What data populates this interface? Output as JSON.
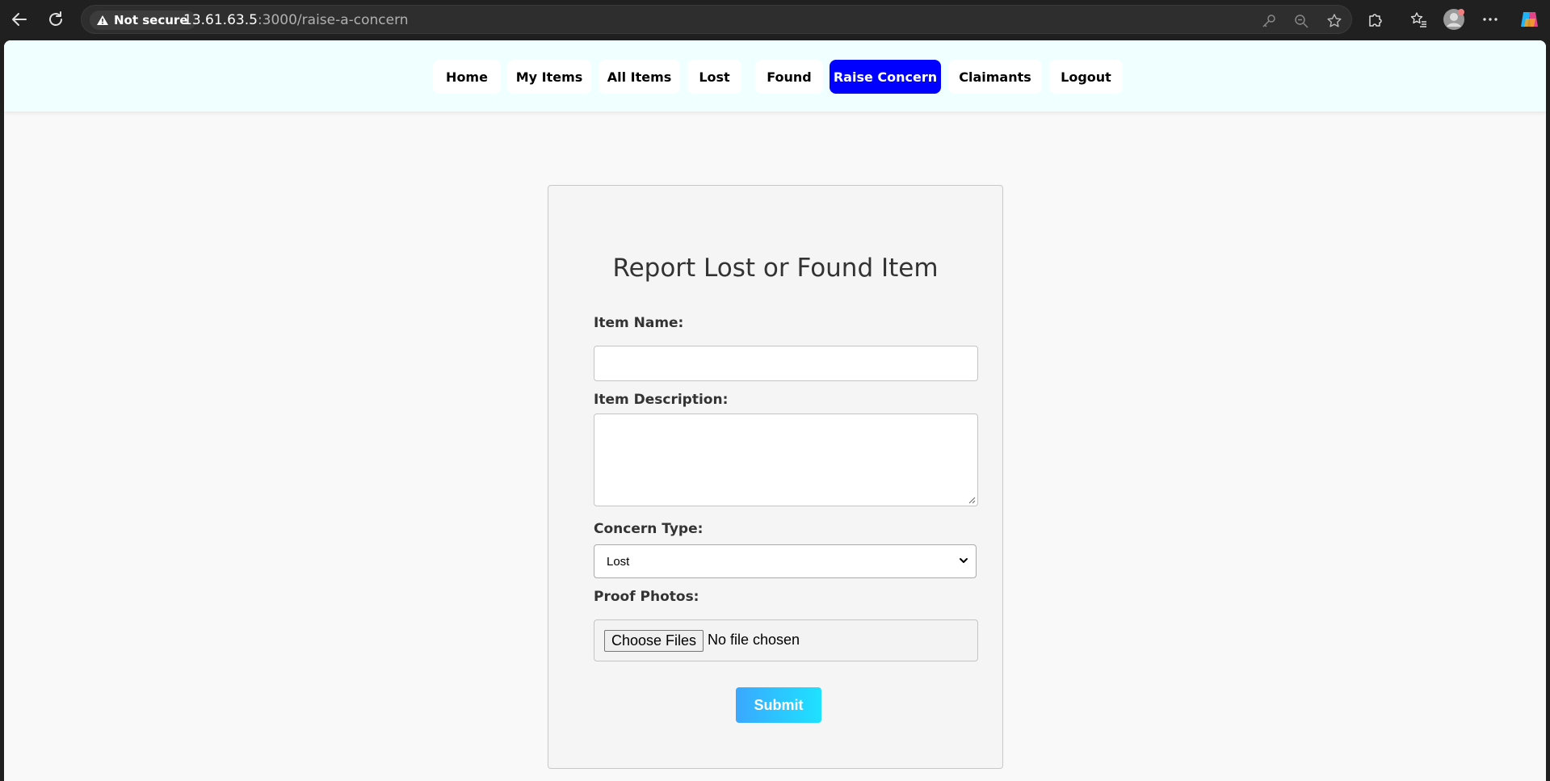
{
  "browser": {
    "security_label": "Not secure",
    "url_host": "13.61.63.5",
    "url_rest": ":3000/raise-a-concern"
  },
  "nav": {
    "items": [
      {
        "label": "Home",
        "active": false
      },
      {
        "label": "My Items",
        "active": false
      },
      {
        "label": "All Items",
        "active": false
      },
      {
        "label": "Lost",
        "active": false
      },
      {
        "label": "Found",
        "active": false
      },
      {
        "label": "Raise Concern",
        "active": true
      },
      {
        "label": "Claimants",
        "active": false
      },
      {
        "label": "Logout",
        "active": false
      }
    ]
  },
  "form": {
    "title": "Report Lost or Found Item",
    "item_name_label": "Item Name:",
    "item_name_value": "",
    "item_description_label": "Item Description:",
    "item_description_value": "",
    "concern_type_label": "Concern Type:",
    "concern_type_value": "Lost",
    "proof_photos_label": "Proof Photos:",
    "choose_files_label": "Choose Files",
    "no_file_text": "No file chosen",
    "submit_label": "Submit"
  },
  "colors": {
    "active_nav": "#0000ff",
    "nav_background": "#f0ffff",
    "submit_gradient_start": "#3aa8ff",
    "submit_gradient_end": "#1ee2ff"
  }
}
